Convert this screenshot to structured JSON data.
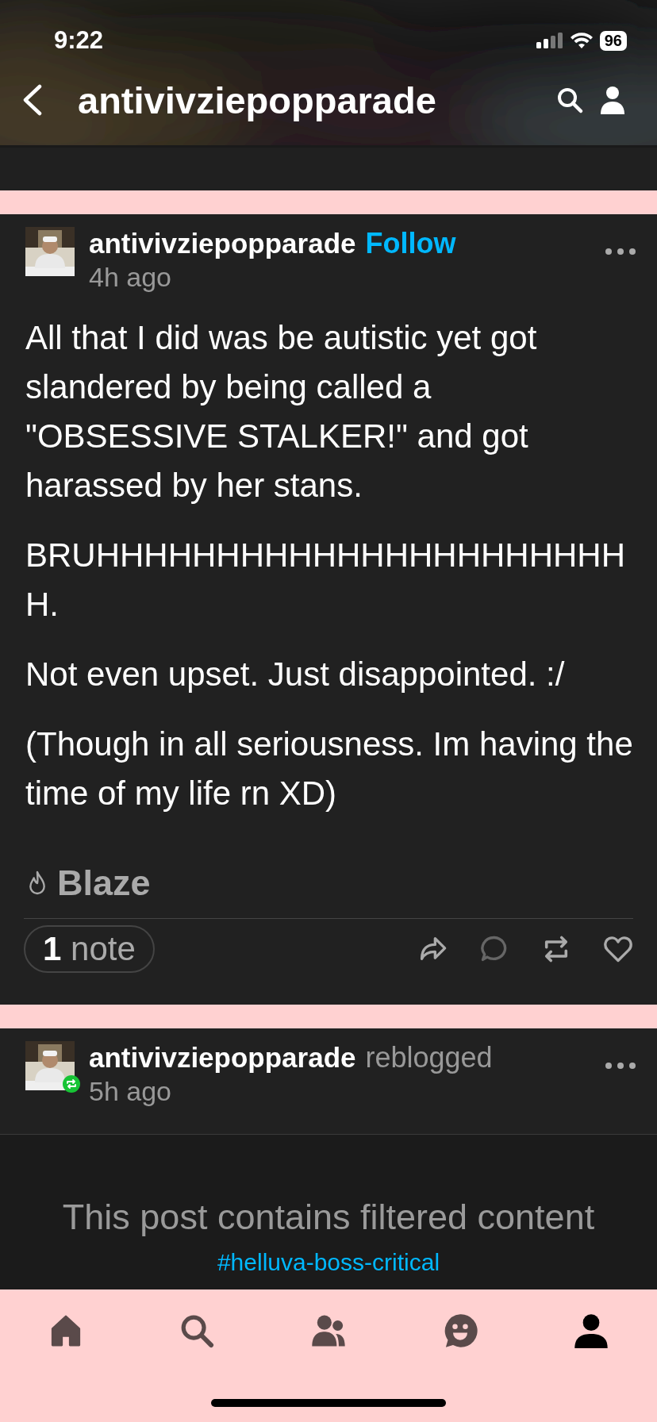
{
  "status_bar": {
    "time": "9:22",
    "battery": "96"
  },
  "header": {
    "title": "antivivziepopparade"
  },
  "posts": [
    {
      "kind": "post",
      "author": "antivivziepopparade",
      "follow": "Follow",
      "time": "4h ago",
      "paragraphs": [
        "All that I did was be autistic yet got slandered by being called a \"OBSESSIVE STALKER!\" and got harassed by her stans.",
        "BRUHHHHHHHHHHHHHHHHHHHHHHH.",
        "Not even upset. Just disappointed. :/",
        "(Though in all seriousness. Im having the time of my life rn XD)"
      ],
      "blaze": "Blaze",
      "notes_count": "1",
      "notes_label": "note",
      "actions": [
        {
          "kind": "share",
          "disabled": false
        },
        {
          "kind": "reply",
          "disabled": true
        },
        {
          "kind": "reblog",
          "disabled": false
        },
        {
          "kind": "like",
          "disabled": false
        }
      ]
    },
    {
      "kind": "reblog",
      "author": "antivivziepopparade",
      "action": "reblogged",
      "time": "5h ago",
      "filtered": "This post contains filtered content",
      "tag": "#helluva-boss-critical"
    }
  ],
  "tab_bar": [
    {
      "kind": "home",
      "selected": false
    },
    {
      "kind": "search",
      "selected": false
    },
    {
      "kind": "people",
      "selected": false
    },
    {
      "kind": "chat",
      "selected": false
    },
    {
      "kind": "account",
      "selected": true
    }
  ]
}
